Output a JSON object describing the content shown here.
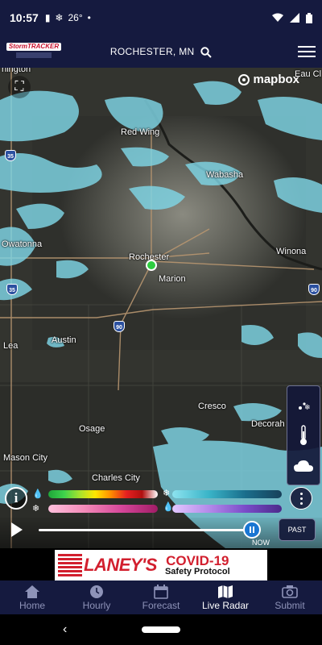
{
  "status_bar": {
    "time": "10:57",
    "temp": "26°",
    "icons": [
      "sd-card-icon",
      "snowflake-icon",
      "dot-icon",
      "wifi-icon",
      "signal-icon",
      "battery-icon"
    ]
  },
  "header": {
    "logo_text": "StormTRACKER",
    "location": "ROCHESTER, MN"
  },
  "map": {
    "attribution": "mapbox",
    "places": [
      {
        "name": "Red Wing"
      },
      {
        "name": "Wabasha"
      },
      {
        "name": "Owatonna"
      },
      {
        "name": "Rochester"
      },
      {
        "name": "Marion"
      },
      {
        "name": "Winona"
      },
      {
        "name": "Austin"
      },
      {
        "name": "Lea"
      },
      {
        "name": "Cresco"
      },
      {
        "name": "Osage"
      },
      {
        "name": "Decorah"
      },
      {
        "name": "Mason City"
      },
      {
        "name": "Charles City"
      },
      {
        "name": "Eau Cl"
      },
      {
        "name": "nington"
      }
    ],
    "highways": [
      "35",
      "35",
      "90",
      "90"
    ]
  },
  "timeline": {
    "now_label": "NOW",
    "past_label": "PAST",
    "progress": 0.96
  },
  "ad": {
    "brand": "LANEY'S",
    "headline": "COVID-19",
    "subline": "Safety Protocol"
  },
  "nav": [
    {
      "label": "Home",
      "icon": "home-icon"
    },
    {
      "label": "Hourly",
      "icon": "clock-icon"
    },
    {
      "label": "Forecast",
      "icon": "calendar-icon"
    },
    {
      "label": "Live Radar",
      "icon": "map-icon",
      "active": true
    },
    {
      "label": "Submit",
      "icon": "camera-icon"
    }
  ],
  "colors": {
    "nav_bg": "#151a3f",
    "radar_snow": "#7fd6e6",
    "accent": "#1976d2"
  }
}
